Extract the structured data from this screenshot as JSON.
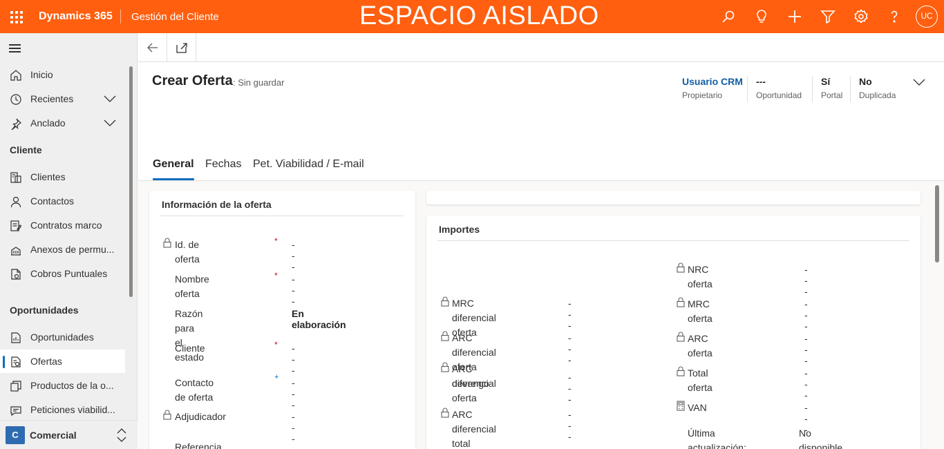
{
  "topbar": {
    "brand": "Dynamics 365",
    "app_name": "Gestión del Cliente",
    "environment_label": "ESPACIO AISLADO",
    "avatar_initials": "UC",
    "icons": [
      "waffle-icon",
      "search-icon",
      "lightbulb-icon",
      "plus-icon",
      "filter-icon",
      "gear-icon",
      "help-icon"
    ]
  },
  "sidebar": {
    "top_items": [
      {
        "label": "Inicio",
        "icon": "home-icon"
      },
      {
        "label": "Recientes",
        "icon": "clock-icon"
      },
      {
        "label": "Anclado",
        "icon": "pin-icon"
      }
    ],
    "groups": [
      {
        "title": "Cliente",
        "items": [
          {
            "label": "Clientes",
            "icon": "accounts-icon"
          },
          {
            "label": "Contactos",
            "icon": "person-icon"
          },
          {
            "label": "Contratos marco",
            "icon": "contract-icon"
          },
          {
            "label": "Anexos de permu...",
            "icon": "building-icon"
          },
          {
            "label": "Cobros Puntuales",
            "icon": "document-icon"
          }
        ]
      },
      {
        "title": "Oportunidades",
        "items": [
          {
            "label": "Oportunidades",
            "icon": "opportunity-icon"
          },
          {
            "label": "Ofertas",
            "icon": "quote-icon",
            "selected": true
          },
          {
            "label": "Productos de la o...",
            "icon": "products-icon"
          },
          {
            "label": "Peticiones viabilid...",
            "icon": "request-icon"
          }
        ]
      }
    ],
    "area": {
      "badge": "C",
      "label": "Comercial"
    }
  },
  "header": {
    "title": "Crear Oferta",
    "subtitle": ": Sin guardar",
    "fields": [
      {
        "value": "Usuario CRM",
        "label": "Propietario"
      },
      {
        "value": "---",
        "label": "Oportunidad"
      },
      {
        "value": "Sí",
        "label": "Portal"
      },
      {
        "value": "No",
        "label": "Duplicada"
      }
    ],
    "tabs": [
      "General",
      "Fechas",
      "Pet. Viabilidad / E-mail"
    ]
  },
  "info_section": {
    "title": "Información de la oferta",
    "fields": [
      {
        "label": "Id. de oferta",
        "value": "---",
        "locked": true,
        "required": "*"
      },
      {
        "label": "Nombre oferta",
        "value": "---",
        "locked": false,
        "required": "*"
      },
      {
        "label": "Razón para el estado",
        "value": "En elaboración",
        "locked": false,
        "bold": true
      },
      {
        "label": "Cliente",
        "value": "---",
        "locked": false,
        "required": "*"
      },
      {
        "label": "Contacto de oferta",
        "value": "---",
        "locked": false,
        "recommended": "+"
      },
      {
        "label": "Adjudicador",
        "value": "---",
        "locked": true
      },
      {
        "label": "Referencia oferta",
        "value": "",
        "locked": false
      }
    ]
  },
  "importes": {
    "title": "Importes",
    "left_fields": [
      {
        "label": "MRC diferencial oferta",
        "value": "---"
      },
      {
        "label": "ARC diferencial oferta",
        "value": "---"
      },
      {
        "label_line1": "ARC diferencial",
        "label_line2": "devengo oferta",
        "value": "---"
      },
      {
        "label": "ARC diferencial total",
        "value": "---"
      }
    ],
    "right_fields": [
      {
        "label": "NRC oferta",
        "value": "---"
      },
      {
        "label": "MRC oferta",
        "value": "---"
      },
      {
        "label": "ARC oferta",
        "value": "---"
      },
      {
        "label": "Total oferta",
        "value": "---"
      },
      {
        "label": "VAN",
        "value": "---"
      }
    ],
    "last_update_label": "Última actualización:",
    "last_update_value": "No disponible"
  },
  "colors": {
    "topbar": "#ff5f0f",
    "accent": "#0f6cbd",
    "link": "#115ea3",
    "required": "#c50f1f",
    "area_badge": "#2f6bb0"
  }
}
